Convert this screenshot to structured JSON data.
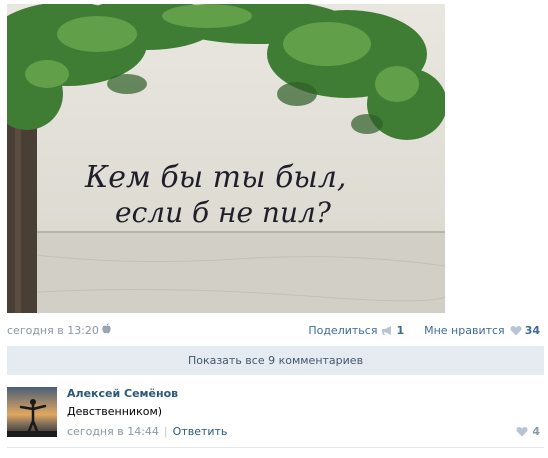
{
  "post": {
    "photo_text_line1": "Кем бы ты был,",
    "photo_text_line2": "если б не пил?",
    "date": "сегодня в 13:20",
    "device_icon": "apple-icon",
    "share_label": "Поделиться",
    "share_count": "1",
    "like_label": "Мне нравится",
    "like_count": "34"
  },
  "show_all_comments": "Показать все 9 комментариев",
  "comment": {
    "author": "Алексей Семёнов",
    "text": "Девственником)",
    "date": "сегодня в 14:44",
    "reply_label": "Ответить",
    "likes": "4"
  },
  "colors": {
    "link": "#2b587a",
    "muted": "#8a97a5",
    "panel": "#e6ebf1",
    "heart": "#b7c4d2"
  }
}
